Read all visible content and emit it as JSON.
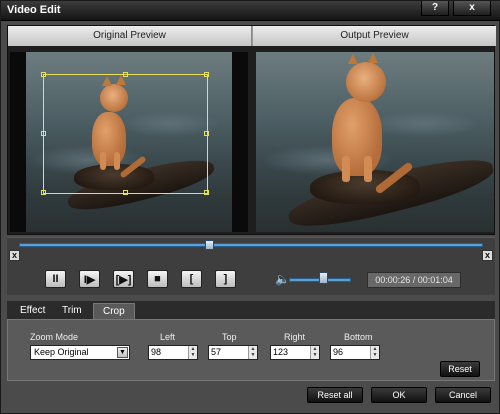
{
  "window": {
    "title": "Video Edit",
    "help_label": "?",
    "close_label": "x"
  },
  "preview": {
    "original_label": "Original Preview",
    "output_label": "Output Preview"
  },
  "timeline": {
    "progress": 0.41,
    "timecode": "00:00:26 / 00:01:04",
    "volume": 0.55,
    "start_marker": "x",
    "end_marker": "x"
  },
  "controls": {
    "pause": "II",
    "step": "I▶",
    "frame": "[▶]",
    "stop": "■",
    "mark_in": "[",
    "mark_out": "]"
  },
  "tabs": [
    {
      "label": "Effect"
    },
    {
      "label": "Trim"
    },
    {
      "label": "Crop",
      "active": true
    }
  ],
  "crop": {
    "zoom_mode_label": "Zoom Mode",
    "zoom_mode_value": "Keep Original",
    "left_label": "Left",
    "left_value": "98",
    "top_label": "Top",
    "top_value": "57",
    "right_label": "Right",
    "right_value": "123",
    "bottom_label": "Bottom",
    "bottom_value": "96",
    "reset_label": "Reset"
  },
  "footer": {
    "reset_all_label": "Reset all",
    "ok_label": "OK",
    "cancel_label": "Cancel"
  },
  "colors": {
    "crop_frame": "#e6e05a",
    "slider_track": "#5aa0d8"
  }
}
